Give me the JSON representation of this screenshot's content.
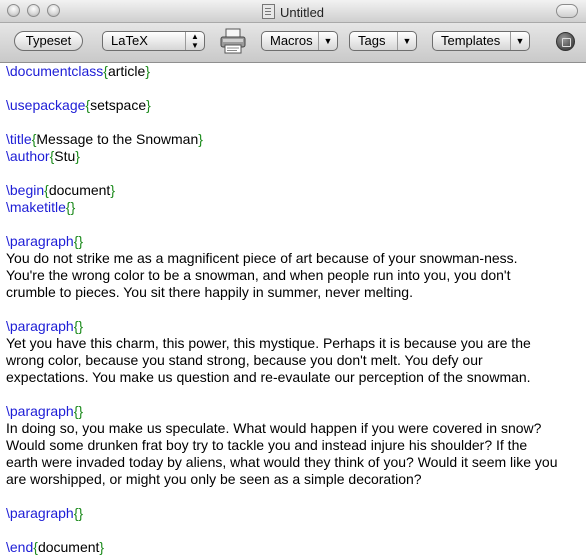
{
  "window": {
    "title": "Untitled"
  },
  "toolbar": {
    "typeset_label": "Typeset",
    "format_value": "LaTeX",
    "macros_label": "Macros",
    "tags_label": "Tags",
    "templates_label": "Templates"
  },
  "colors": {
    "command": "#1d1dd6",
    "brace": "#1b8a1b",
    "text": "#000000"
  },
  "source": {
    "l1_cmd": "\\documentclass",
    "l1_arg": "article",
    "l2_cmd": "\\usepackage",
    "l2_arg": "setspace",
    "l3_cmd": "\\title",
    "l3_arg": "Message to the Snowman",
    "l4_cmd": "\\author",
    "l4_arg": "Stu",
    "l5_cmd": "\\begin",
    "l5_arg": "document",
    "l6_cmd": "\\maketitle",
    "p1_cmd": "\\paragraph",
    "p1_l1": "You do not strike me as a magnificent piece of art because of your snowman-ness.",
    "p1_l2": "You're the wrong color to be a snowman, and when people run into you, you don't",
    "p1_l3": "crumble to pieces. You sit there happily in summer, never melting.",
    "p2_cmd": "\\paragraph",
    "p2_l1": "Yet you have this charm, this power, this mystique. Perhaps it is because you are the",
    "p2_l2": "wrong color, because you stand strong, because you don't melt. You defy our",
    "p2_l3": "expectations. You make us question and re-evaulate our perception of the snowman.",
    "p3_cmd": "\\paragraph",
    "p3_l1": "In doing so, you make us speculate. What would happen if you were covered in snow?",
    "p3_l2": "Would some drunken frat boy try to tackle you and instead injure his shoulder? If the",
    "p3_l3": "earth were invaded today by aliens, what would they think of you? Would it seem like you",
    "p3_l4": "are worshipped, or might you only be seen as a simple decoration?",
    "p4_cmd": "\\paragraph",
    "end_cmd": "\\end",
    "end_arg": "document",
    "lbrace": "{",
    "rbrace": "}"
  }
}
